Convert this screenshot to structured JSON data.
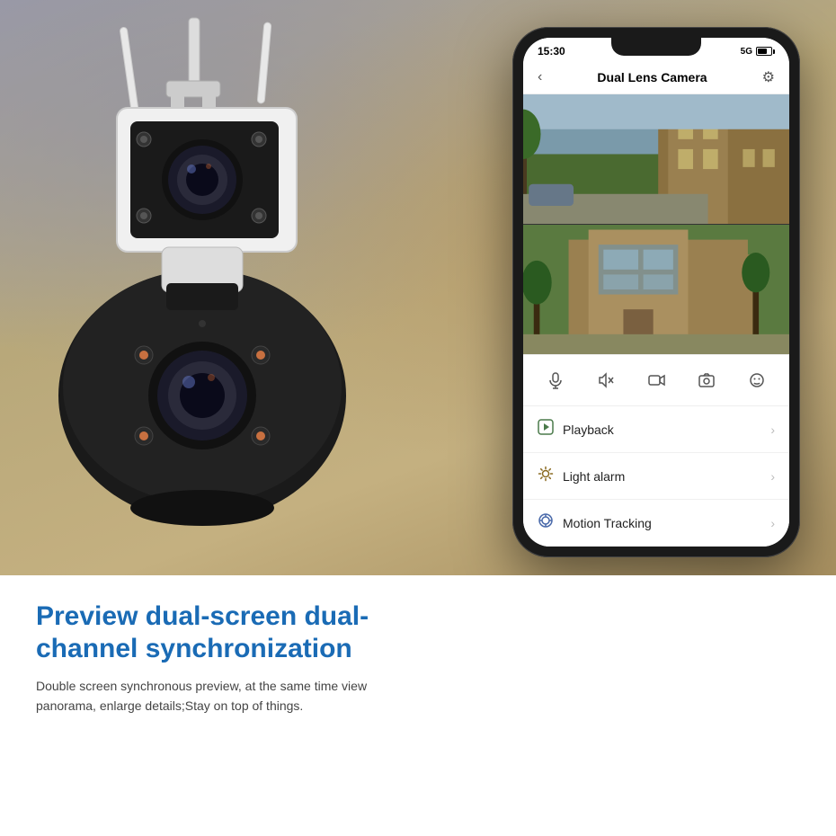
{
  "page": {
    "background_top": "#b8b0a0",
    "background_bottom": "#ffffff"
  },
  "phone": {
    "status": {
      "time": "15:30",
      "network": "5G"
    },
    "header": {
      "title": "Dual Lens Camera",
      "back_icon": "‹",
      "settings_icon": "⚙"
    },
    "controls": [
      {
        "icon": "🎤",
        "label": "microphone"
      },
      {
        "icon": "🔇",
        "label": "mute"
      },
      {
        "icon": "⬜",
        "label": "record"
      },
      {
        "icon": "📷",
        "label": "snapshot"
      },
      {
        "icon": "☺",
        "label": "face"
      }
    ],
    "menu_items": [
      {
        "icon": "▶",
        "text": "Playback",
        "has_arrow": true
      },
      {
        "icon": "🔔",
        "text": "Light alarm",
        "has_arrow": true
      },
      {
        "icon": "⊕",
        "text": "Motion Tracking",
        "has_arrow": true
      }
    ]
  },
  "text_content": {
    "headline": "Preview dual-screen dual-channel synchronization",
    "description": "Double screen synchronous preview, at the same time view panorama, enlarge details;Stay on top of things."
  }
}
